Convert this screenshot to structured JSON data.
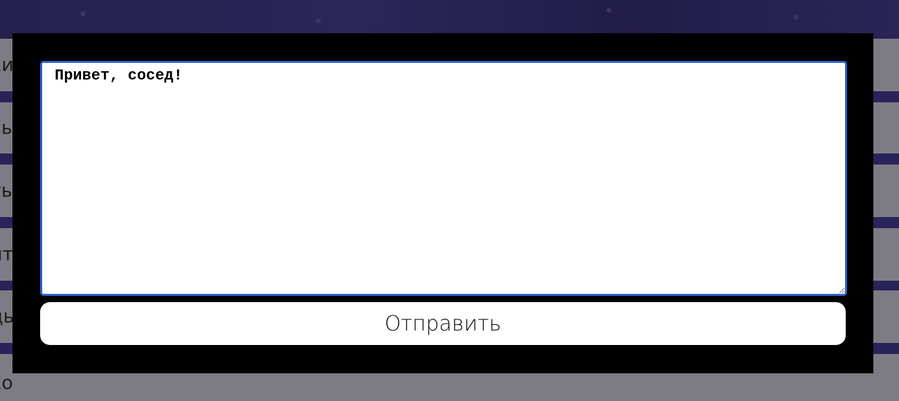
{
  "background": {
    "rows": [
      {
        "label": "ки"
      },
      {
        "label": "вы"
      },
      {
        "label": "ть"
      },
      {
        "label": "ит"
      },
      {
        "label": "дь"
      },
      {
        "label": "ко"
      }
    ]
  },
  "modal": {
    "message_value": "Привет, сосед!",
    "send_label": "Отправить"
  },
  "colors": {
    "modal_bg": "#000000",
    "input_border": "#2d62c8",
    "backdrop_row": "#7d7c84",
    "backdrop_stripe": "#29235a"
  }
}
